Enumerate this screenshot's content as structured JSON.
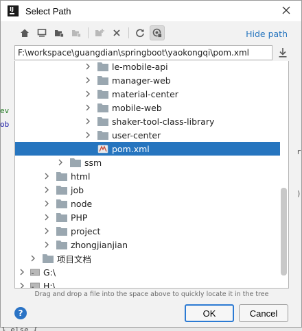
{
  "window": {
    "title": "Select Path"
  },
  "background": {
    "fragment_1": "ev",
    "fragment_2": "ob",
    "fragment_3": "r",
    "fragment_4": ")",
    "fragment_5": "} else {"
  },
  "toolbar": {
    "buttons": [
      "home-icon",
      "desktop-icon",
      "project-folder-icon",
      "module-folder-icon",
      "new-folder-icon",
      "delete-icon",
      "refresh-icon",
      "show-hidden-icon"
    ],
    "hide_path_label": "Hide path"
  },
  "path": {
    "value": "F:\\workspace\\guangdian\\springboot\\yaokongqi\\pom.xml"
  },
  "tree": {
    "items": [
      {
        "label": "le-mobile-api",
        "type": "folder",
        "expandable": true
      },
      {
        "label": "manager-web",
        "type": "folder",
        "expandable": true
      },
      {
        "label": "material-center",
        "type": "folder",
        "expandable": true
      },
      {
        "label": "mobile-web",
        "type": "folder",
        "expandable": true
      },
      {
        "label": "shaker-tool-class-library",
        "type": "folder",
        "expandable": true
      },
      {
        "label": "user-center",
        "type": "folder",
        "expandable": true
      },
      {
        "label": "pom.xml",
        "type": "file",
        "expandable": false,
        "selected": true
      },
      {
        "label": "ssm",
        "type": "folder",
        "expandable": true
      },
      {
        "label": "html",
        "type": "folder",
        "expandable": true
      },
      {
        "label": "job",
        "type": "folder",
        "expandable": true
      },
      {
        "label": "node",
        "type": "folder",
        "expandable": true
      },
      {
        "label": "PHP",
        "type": "folder",
        "expandable": true
      },
      {
        "label": "project",
        "type": "folder",
        "expandable": true
      },
      {
        "label": "zhongjianjian",
        "type": "folder",
        "expandable": true
      },
      {
        "label": "项目文档",
        "type": "folder",
        "expandable": true
      },
      {
        "label": "G:\\",
        "type": "drive",
        "expandable": true
      },
      {
        "label": "H:\\",
        "type": "drive",
        "expandable": true
      }
    ]
  },
  "hint": "Drag and drop a file into the space above to quickly locate it in the tree",
  "buttons": {
    "help_label": "?",
    "ok_label": "OK",
    "cancel_label": "Cancel"
  },
  "colors": {
    "selection": "#2675bf",
    "link": "#2675bf",
    "folder": "#9aa7b0",
    "ok_border": "#2b7ad3"
  }
}
